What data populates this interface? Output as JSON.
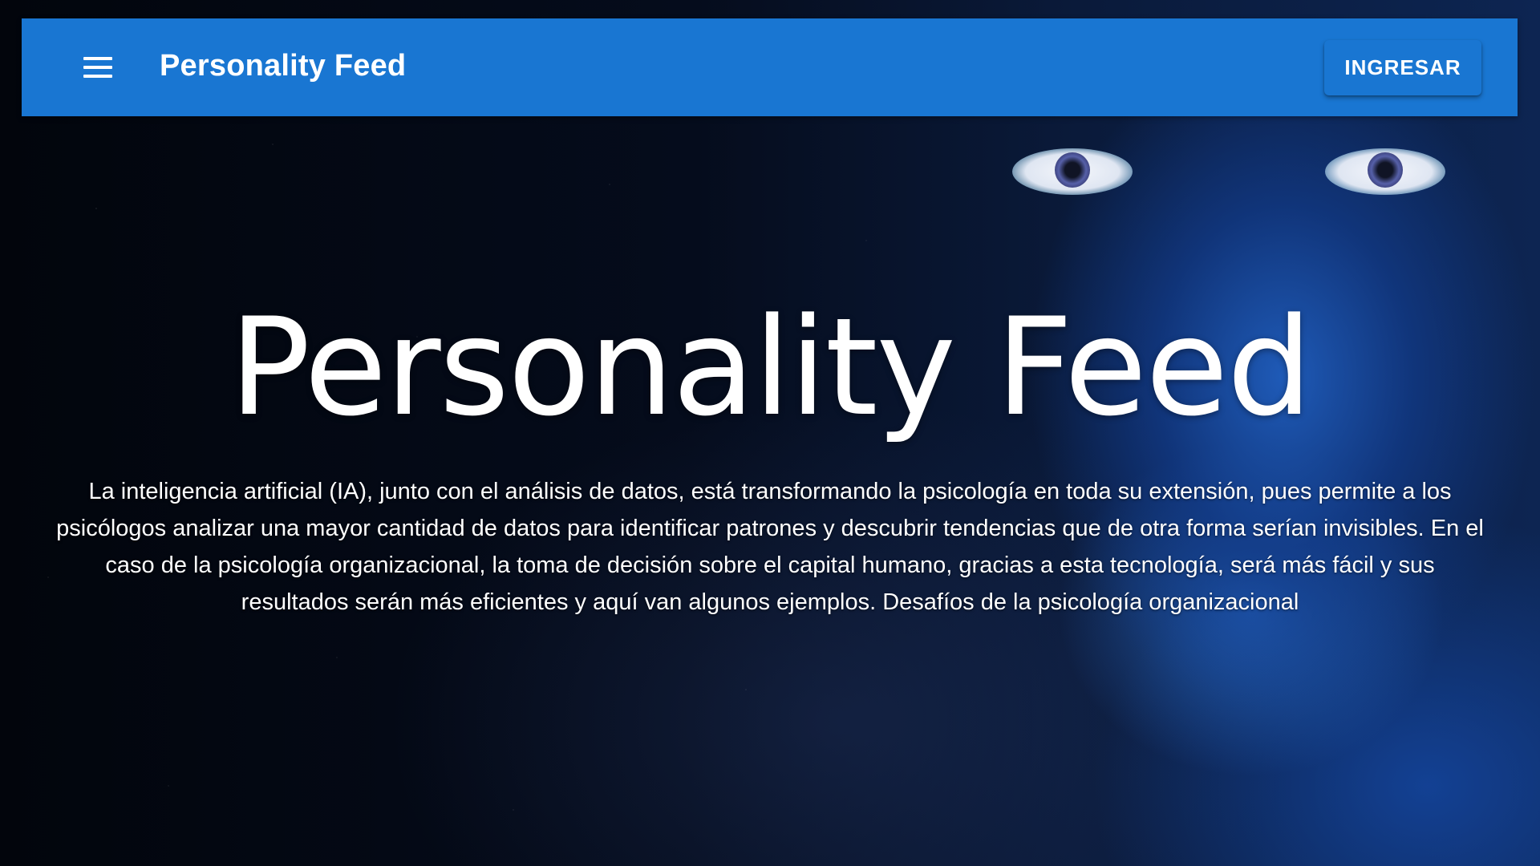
{
  "header": {
    "menu_icon": "hamburger-menu-icon",
    "title": "Personality Feed",
    "login_label": "INGRESAR",
    "background_color": "#1976d2"
  },
  "hero": {
    "title": "Personality Feed",
    "description": "La inteligencia artificial (IA), junto con el análisis de datos, está transformando la psicología en toda su extensión, pues permite a los psicólogos analizar una mayor cantidad de datos para identificar patrones y descubrir tendencias que de otra forma serían invisibles. En el caso de la psicología organizacional, la toma de decisión sobre el capital humano, gracias a esta tecnología, será más fácil y sus resultados serán más eficientes y aquí van algunos ejemplos. Desafíos de la psicología organizacional"
  }
}
